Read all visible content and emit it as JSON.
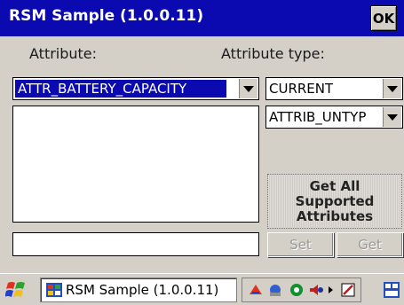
{
  "window": {
    "title": "RSM Sample (1.0.0.11)",
    "ok_label": "OK"
  },
  "labels": {
    "attribute": "Attribute:",
    "attribute_type": "Attribute type:"
  },
  "attribute_select": {
    "value": "ATTR_BATTERY_CAPACITY"
  },
  "type_select": {
    "value": "CURRENT"
  },
  "untyp_select": {
    "value": "ATTRIB_UNTYP"
  },
  "buttons": {
    "get_all": [
      "Get All",
      "Supported",
      "Attributes"
    ],
    "set": "Set",
    "get": "Get"
  },
  "taskbar": {
    "task_label": "RSM Sample (1.0.0.11)"
  },
  "colors": {
    "title_bar": "#0a0ab0",
    "selection": "#0a0ab0",
    "background": "#d4d0c8"
  },
  "icons": [
    "start-icon",
    "app-icon",
    "network-icon",
    "sync-icon",
    "wifi-icon",
    "volume-icon",
    "tray-arrow-icon",
    "sip-keyboard-icon",
    "desktop-icon"
  ]
}
